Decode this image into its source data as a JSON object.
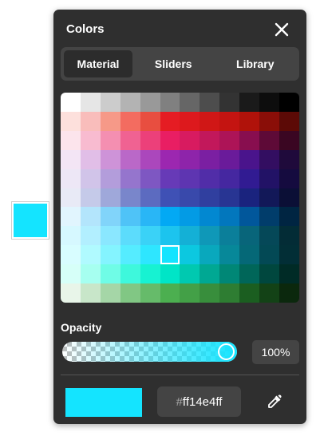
{
  "panel": {
    "title": "Colors"
  },
  "tabs": [
    {
      "label": "Material",
      "active": true
    },
    {
      "label": "Sliders",
      "active": false
    },
    {
      "label": "Library",
      "active": false
    }
  ],
  "opacity": {
    "label": "Opacity",
    "value_text": "100%",
    "value": 1.0
  },
  "current_color": {
    "hex_prefix": "#",
    "hex_value": "ff14e4ff",
    "color": "#14e4ff"
  },
  "external_swatch_color": "#14e4ff",
  "selected_cell": {
    "row": 8,
    "col": 5
  },
  "palette": [
    [
      "#ffffff",
      "#e6e6e6",
      "#cccccc",
      "#b3b3b3",
      "#999999",
      "#808080",
      "#666666",
      "#4d4d4d",
      "#333333",
      "#1a1a1a",
      "#0d0d0d",
      "#000000"
    ],
    [
      "#fde0dc",
      "#f9bdbb",
      "#f69988",
      "#f36c60",
      "#e84e40",
      "#e51c23",
      "#dd191d",
      "#d01716",
      "#c41411",
      "#b0120a",
      "#8a0e08",
      "#5c0a06"
    ],
    [
      "#fce4ec",
      "#f8bbd0",
      "#f48fb1",
      "#f06292",
      "#ec407a",
      "#e91e63",
      "#d81b60",
      "#c2185b",
      "#ad1457",
      "#880e4f",
      "#5e0a37",
      "#3a0622"
    ],
    [
      "#f3e5f5",
      "#e1bee7",
      "#ce93d8",
      "#ba68c8",
      "#ab47bc",
      "#9c27b0",
      "#8e24aa",
      "#7b1fa2",
      "#6a1b9a",
      "#4a148c",
      "#330e61",
      "#1f0a3b"
    ],
    [
      "#ede7f6",
      "#d1c4e9",
      "#b39ddb",
      "#9575cd",
      "#7e57c2",
      "#673ab7",
      "#5e35b1",
      "#512da8",
      "#4527a0",
      "#311b92",
      "#221266",
      "#150b3f"
    ],
    [
      "#e8eaf6",
      "#c5cae9",
      "#9fa8da",
      "#7986cb",
      "#5c6bc0",
      "#3f51b5",
      "#3949ab",
      "#303f9f",
      "#283593",
      "#1a237e",
      "#121858",
      "#0b0f36"
    ],
    [
      "#e1f5fe",
      "#b3e5fc",
      "#81d4fa",
      "#4fc3f7",
      "#29b6f6",
      "#03a9f4",
      "#039be5",
      "#0288d1",
      "#0277bd",
      "#01579b",
      "#013d6b",
      "#002542"
    ],
    [
      "#d6f8ff",
      "#b2efff",
      "#8ae7ff",
      "#5cdcfc",
      "#3ad2f7",
      "#1cc4ee",
      "#14b0d6",
      "#0f98b8",
      "#0b7f9a",
      "#08657a",
      "#054858",
      "#032c36"
    ],
    [
      "#d8fdff",
      "#b0faff",
      "#84f4ff",
      "#55ecff",
      "#2ee6ff",
      "#14e4ff",
      "#0cc8e0",
      "#09a8bd",
      "#078899",
      "#056877",
      "#034955",
      "#022e36"
    ],
    [
      "#d6fff8",
      "#a6fff0",
      "#6ffce6",
      "#3ef8dc",
      "#17f2d2",
      "#00e5c7",
      "#00c9b0",
      "#00a893",
      "#008776",
      "#006659",
      "#00473e",
      "#002b26"
    ],
    [
      "#e8f5e9",
      "#c8e6c9",
      "#a5d6a7",
      "#81c784",
      "#66bb6a",
      "#4caf50",
      "#43a047",
      "#388e3c",
      "#2e7d32",
      "#1b5e20",
      "#134216",
      "#0b280d"
    ]
  ]
}
